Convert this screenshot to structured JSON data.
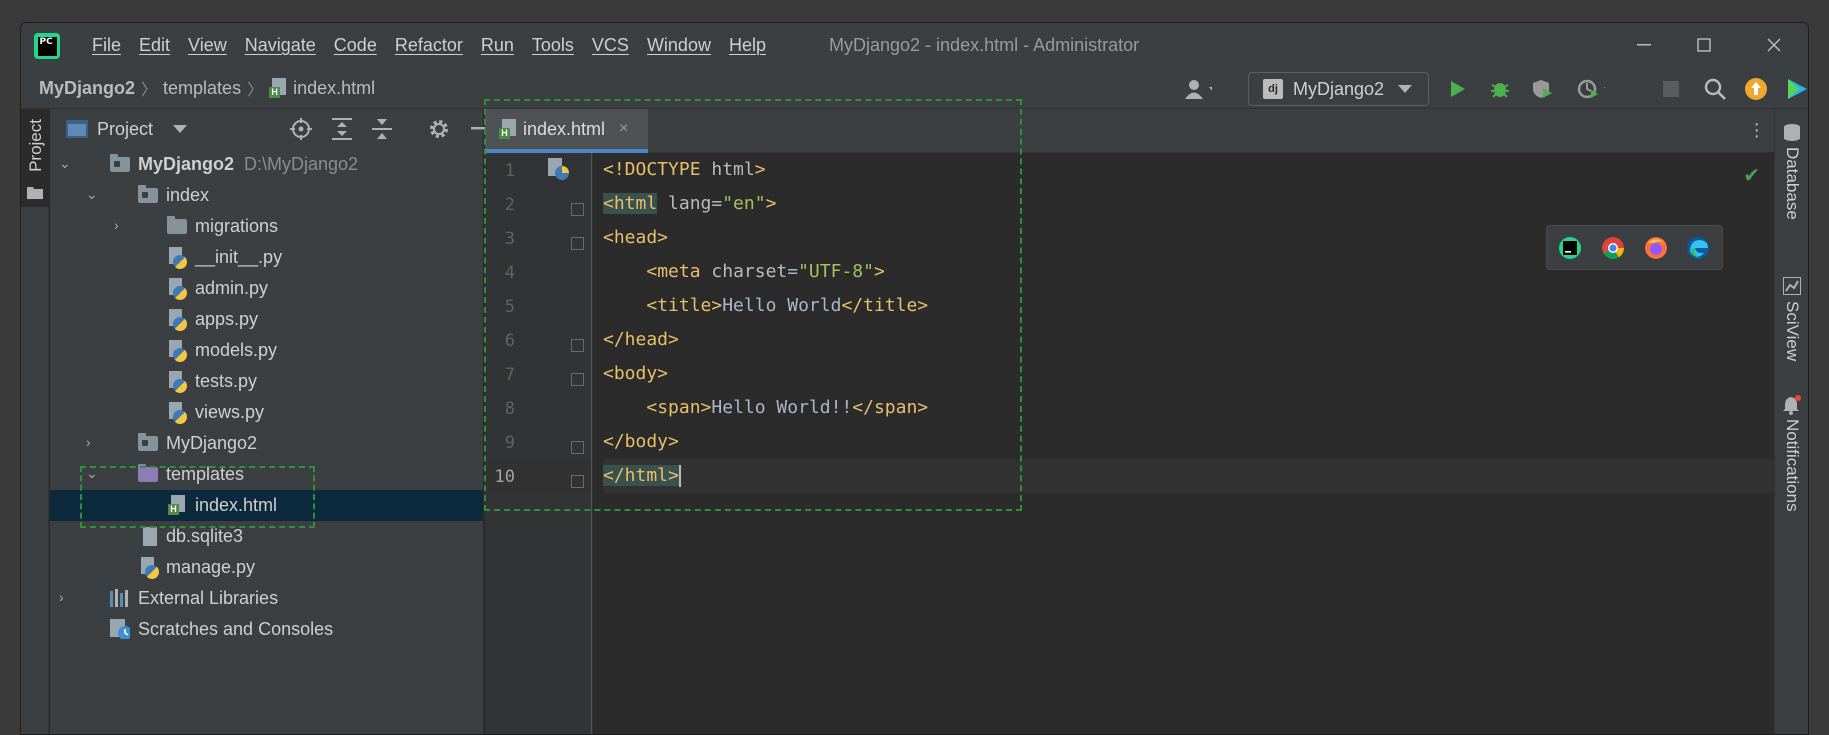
{
  "app": {
    "logo_text": "PC",
    "window_title": "MyDjango2 - index.html - Administrator"
  },
  "menu": [
    "File",
    "Edit",
    "View",
    "Navigate",
    "Code",
    "Refactor",
    "Run",
    "Tools",
    "VCS",
    "Window",
    "Help"
  ],
  "breadcrumb": {
    "project": "MyDjango2",
    "folder": "templates",
    "file": "index.html"
  },
  "run_config": {
    "icon_text": "dj",
    "label": "MyDjango2"
  },
  "left_stripe": {
    "project_tab": "Project"
  },
  "right_stripe": {
    "database": "Database",
    "sciview": "SciView",
    "notifications": "Notifications"
  },
  "project_panel": {
    "title": "Project",
    "tree": [
      {
        "label": "MyDjango2",
        "path": "D:\\MyDjango2",
        "bold": true,
        "level": 0,
        "arrow": "open",
        "icon": "module-folder"
      },
      {
        "label": "index",
        "level": 1,
        "arrow": "open",
        "icon": "module-folder"
      },
      {
        "label": "migrations",
        "level": 2,
        "arrow": "closed",
        "icon": "folder"
      },
      {
        "label": "__init__.py",
        "level": 2,
        "icon": "python-file"
      },
      {
        "label": "admin.py",
        "level": 2,
        "icon": "python-file"
      },
      {
        "label": "apps.py",
        "level": 2,
        "icon": "python-file"
      },
      {
        "label": "models.py",
        "level": 2,
        "icon": "python-file"
      },
      {
        "label": "tests.py",
        "level": 2,
        "icon": "python-file"
      },
      {
        "label": "views.py",
        "level": 2,
        "icon": "python-file"
      },
      {
        "label": "MyDjango2",
        "level": 1,
        "arrow": "closed",
        "icon": "module-folder"
      },
      {
        "label": "templates",
        "level": 1,
        "arrow": "open",
        "icon": "templates-folder"
      },
      {
        "label": "index.html",
        "level": 2,
        "icon": "html-file",
        "selected": true
      },
      {
        "label": "db.sqlite3",
        "level": 1,
        "icon": "db-file"
      },
      {
        "label": "manage.py",
        "level": 1,
        "icon": "python-file"
      },
      {
        "label": "External Libraries",
        "level": 0,
        "arrow": "closed",
        "icon": "libraries"
      },
      {
        "label": "Scratches and Consoles",
        "level": 0,
        "icon": "scratches"
      }
    ]
  },
  "editor": {
    "tab_label": "index.html",
    "tab_close": "×",
    "current_line": 10,
    "line_numbers": [
      "1",
      "2",
      "3",
      "4",
      "5",
      "6",
      "7",
      "8",
      "9",
      "10"
    ],
    "lines": [
      [
        [
          "tg",
          "<!DOCTYPE "
        ],
        [
          "at",
          "html"
        ],
        [
          "tg",
          ">"
        ]
      ],
      [
        [
          "tg hl",
          "<html"
        ],
        [
          "at",
          " lang"
        ],
        [
          "tx",
          "="
        ],
        [
          "av",
          "\"en\""
        ],
        [
          "tg",
          ">"
        ]
      ],
      [
        [
          "tg",
          "<head>"
        ]
      ],
      [
        [
          "tx",
          "    "
        ],
        [
          "tg",
          "<meta "
        ],
        [
          "at",
          "charset"
        ],
        [
          "tx",
          "="
        ],
        [
          "av",
          "\"UTF-8\""
        ],
        [
          "tg",
          ">"
        ]
      ],
      [
        [
          "tx",
          "    "
        ],
        [
          "tg",
          "<title>"
        ],
        [
          "tx",
          "Hello World"
        ],
        [
          "tg",
          "</title>"
        ]
      ],
      [
        [
          "tg",
          "</head>"
        ]
      ],
      [
        [
          "tg",
          "<body>"
        ]
      ],
      [
        [
          "tx",
          "    "
        ],
        [
          "tg",
          "<span>"
        ],
        [
          "tx",
          "Hello World!!"
        ],
        [
          "tg",
          "</span>"
        ]
      ],
      [
        [
          "tg",
          "</body>"
        ]
      ],
      [
        [
          "tg hl",
          "</html>"
        ]
      ]
    ],
    "browsers": [
      "pycharm-icon",
      "chrome-icon",
      "firefox-icon",
      "edge-icon"
    ]
  },
  "colors": {
    "accent": "#4a88c7",
    "selection": "#0d293e",
    "tag": "#e8bf6a",
    "string": "#a5c25c",
    "run": "#4caf50"
  }
}
